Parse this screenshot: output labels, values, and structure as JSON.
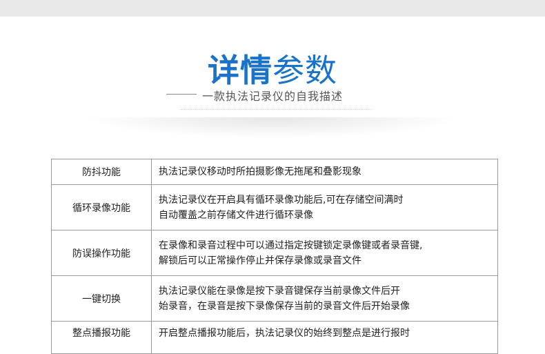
{
  "header": {
    "title_bold": "详情",
    "title_light": "参数",
    "subtitle": "一款执法记录仪的自我描述"
  },
  "params": [
    {
      "name": "防抖功能",
      "lines": [
        "执法记录仪移动时所拍摄影像无拖尾和叠影现象"
      ]
    },
    {
      "name": "循环录像功能",
      "lines": [
        "执法记录仪在开启具有循环录像功能后,可在存储空间满时",
        "自动覆盖之前存储文件进行循环录像"
      ]
    },
    {
      "name": "防误操作功能",
      "lines": [
        "在录像和录音过程中可以通过指定按键锁定录像键或者录音键,",
        "解锁后可以正常操作停止并保存录像或录音文件"
      ]
    },
    {
      "name": "一键切换",
      "lines": [
        "执法记录仪能在录像是按下录音键保存当前录像文件后开",
        "始录音，在录音是按下录像保存当前的录音文件后开始录像"
      ]
    },
    {
      "name": "整点播报功能",
      "lines": [
        "开启整点播报功能后，执法记录仪的始终到整点是进行报时"
      ]
    }
  ],
  "colors": {
    "accent": "#1a72c9",
    "border": "#9a9a9a",
    "top_bar": "#e9e9e9"
  }
}
